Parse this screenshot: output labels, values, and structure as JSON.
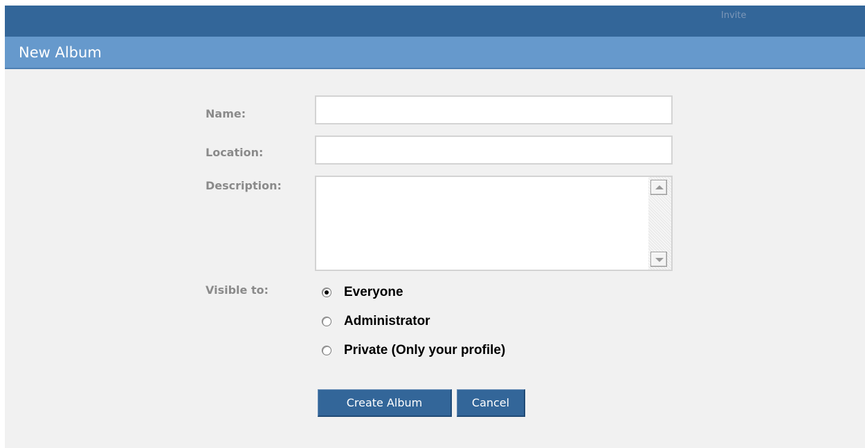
{
  "header": {
    "top_link": "Invite"
  },
  "page": {
    "title": "New Album"
  },
  "form": {
    "name_label": "Name:",
    "name_value": "",
    "location_label": "Location:",
    "location_value": "",
    "description_label": "Description:",
    "description_value": "",
    "visible_label": "Visible to:",
    "visibility_options": [
      {
        "label": "Everyone",
        "selected": true
      },
      {
        "label": "Administrator",
        "selected": false
      },
      {
        "label": "Private (Only your profile)",
        "selected": false
      }
    ],
    "create_button": "Create Album",
    "cancel_button": "Cancel"
  }
}
